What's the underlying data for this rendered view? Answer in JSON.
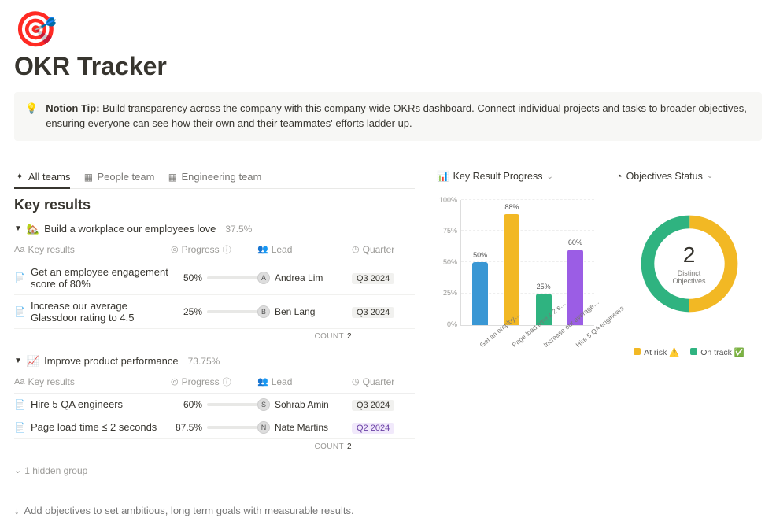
{
  "header": {
    "icon": "🎯",
    "title": "OKR Tracker"
  },
  "callout": {
    "icon": "💡",
    "lead": "Notion Tip:",
    "body": "Build transparency across the company with this company-wide OKRs dashboard. Connect individual projects and tasks to broader objectives, ensuring everyone can see how their own and their teammates' efforts ladder up."
  },
  "tabs": [
    {
      "icon": "✦",
      "label": "All teams",
      "active": true
    },
    {
      "icon": "▦",
      "label": "People team",
      "active": false
    },
    {
      "icon": "▦",
      "label": "Engineering team",
      "active": false
    }
  ],
  "section_title": "Key results",
  "columns_head": {
    "name": "Key results",
    "progress": "Progress",
    "lead": "Lead",
    "quarter": "Quarter"
  },
  "groups": [
    {
      "emoji": "🏡",
      "name": "Build a workplace our employees love",
      "percent": "37.5%",
      "rows": [
        {
          "name": "Get an employee engagement score of 80%",
          "pct_text": "50%",
          "pct": 50,
          "lead": "Andrea Lim",
          "quarter": "Q3 2024",
          "qclass": "q3"
        },
        {
          "name": "Increase our average Glassdoor rating to 4.5",
          "pct_text": "25%",
          "pct": 25,
          "lead": "Ben Lang",
          "quarter": "Q3 2024",
          "qclass": "q3"
        }
      ],
      "count_label": "COUNT",
      "count": "2"
    },
    {
      "emoji": "📈",
      "name": "Improve product performance",
      "percent": "73.75%",
      "rows": [
        {
          "name": "Hire 5 QA engineers",
          "pct_text": "60%",
          "pct": 60,
          "lead": "Sohrab Amin",
          "quarter": "Q3 2024",
          "qclass": "q3"
        },
        {
          "name": "Page load time ≤ 2 seconds",
          "pct_text": "87.5%",
          "pct": 87.5,
          "lead": "Nate Martins",
          "quarter": "Q2 2024",
          "qclass": "q2"
        }
      ],
      "count_label": "COUNT",
      "count": "2"
    }
  ],
  "hidden_group_text": "1 hidden group",
  "footer_note": "Add objectives to set ambitious, long term goals with measurable results.",
  "chart_widget_title": "Key Result Progress",
  "status_widget_title": "Objectives Status",
  "chart_data": {
    "type": "bar",
    "title": "Key Result Progress",
    "ylabel": "",
    "xlabel": "",
    "ylim": [
      0,
      100
    ],
    "yticks": [
      "0%",
      "25%",
      "50%",
      "75%",
      "100%"
    ],
    "categories": [
      "Get an employ…",
      "Page load time ≤ 2 s…",
      "Increase our average…",
      "Hire 5 QA engineers"
    ],
    "values": [
      50,
      88,
      25,
      60
    ],
    "value_labels": [
      "50%",
      "88%",
      "25%",
      "60%"
    ],
    "colors": [
      "#3a97d4",
      "#f2b824",
      "#2fb380",
      "#9b5de5"
    ]
  },
  "donut_data": {
    "type": "pie",
    "title": "Objectives Status",
    "center_value": "2",
    "center_label": "Distinct Objectives",
    "series": [
      {
        "name": "At risk ⚠️",
        "value": 1,
        "color": "#f2b824"
      },
      {
        "name": "On track ✅",
        "value": 1,
        "color": "#2fb380"
      }
    ]
  }
}
